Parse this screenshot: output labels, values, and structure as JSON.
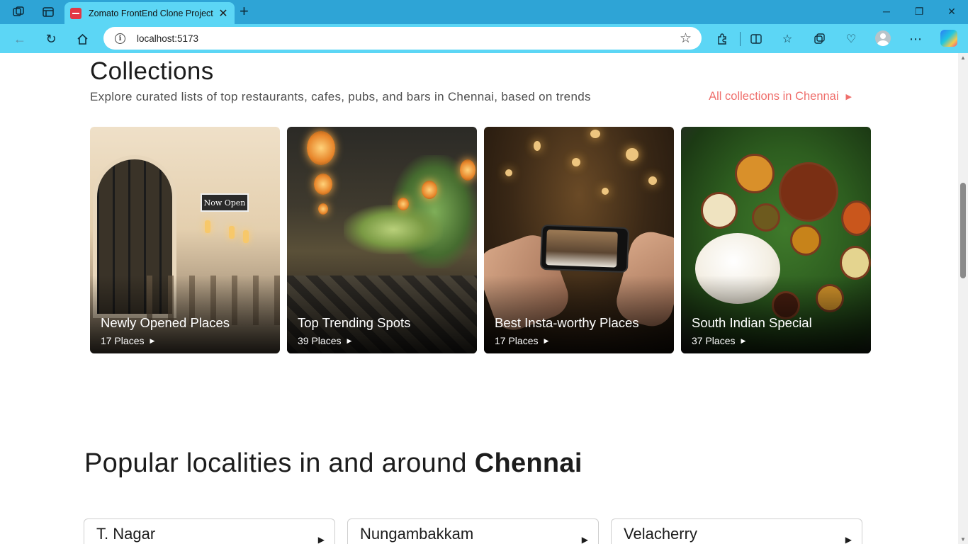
{
  "browser": {
    "tab_title": "Zomato FrontEnd Clone Project",
    "url": "localhost:5173"
  },
  "collections": {
    "title": "Collections",
    "subtitle": "Explore curated lists of top restaurants, cafes, pubs, and bars in Chennai, based on trends",
    "all_link": "All collections in Chennai",
    "cards": [
      {
        "name": "Newly Opened Places",
        "count": "17 Places",
        "sign": "Now Open"
      },
      {
        "name": "Top Trending Spots",
        "count": "39 Places"
      },
      {
        "name": "Best Insta-worthy Places",
        "count": "17 Places"
      },
      {
        "name": "South Indian Special",
        "count": "37 Places"
      }
    ]
  },
  "localities": {
    "title_prefix": "Popular localities in and around ",
    "city": "Chennai",
    "items": [
      {
        "name": "T. Nagar"
      },
      {
        "name": "Nungambakkam"
      },
      {
        "name": "Velacherry"
      }
    ]
  },
  "colors": {
    "accent": "#ef6f6c",
    "brand": "#e23744",
    "chrome": "#5cd6f5"
  }
}
